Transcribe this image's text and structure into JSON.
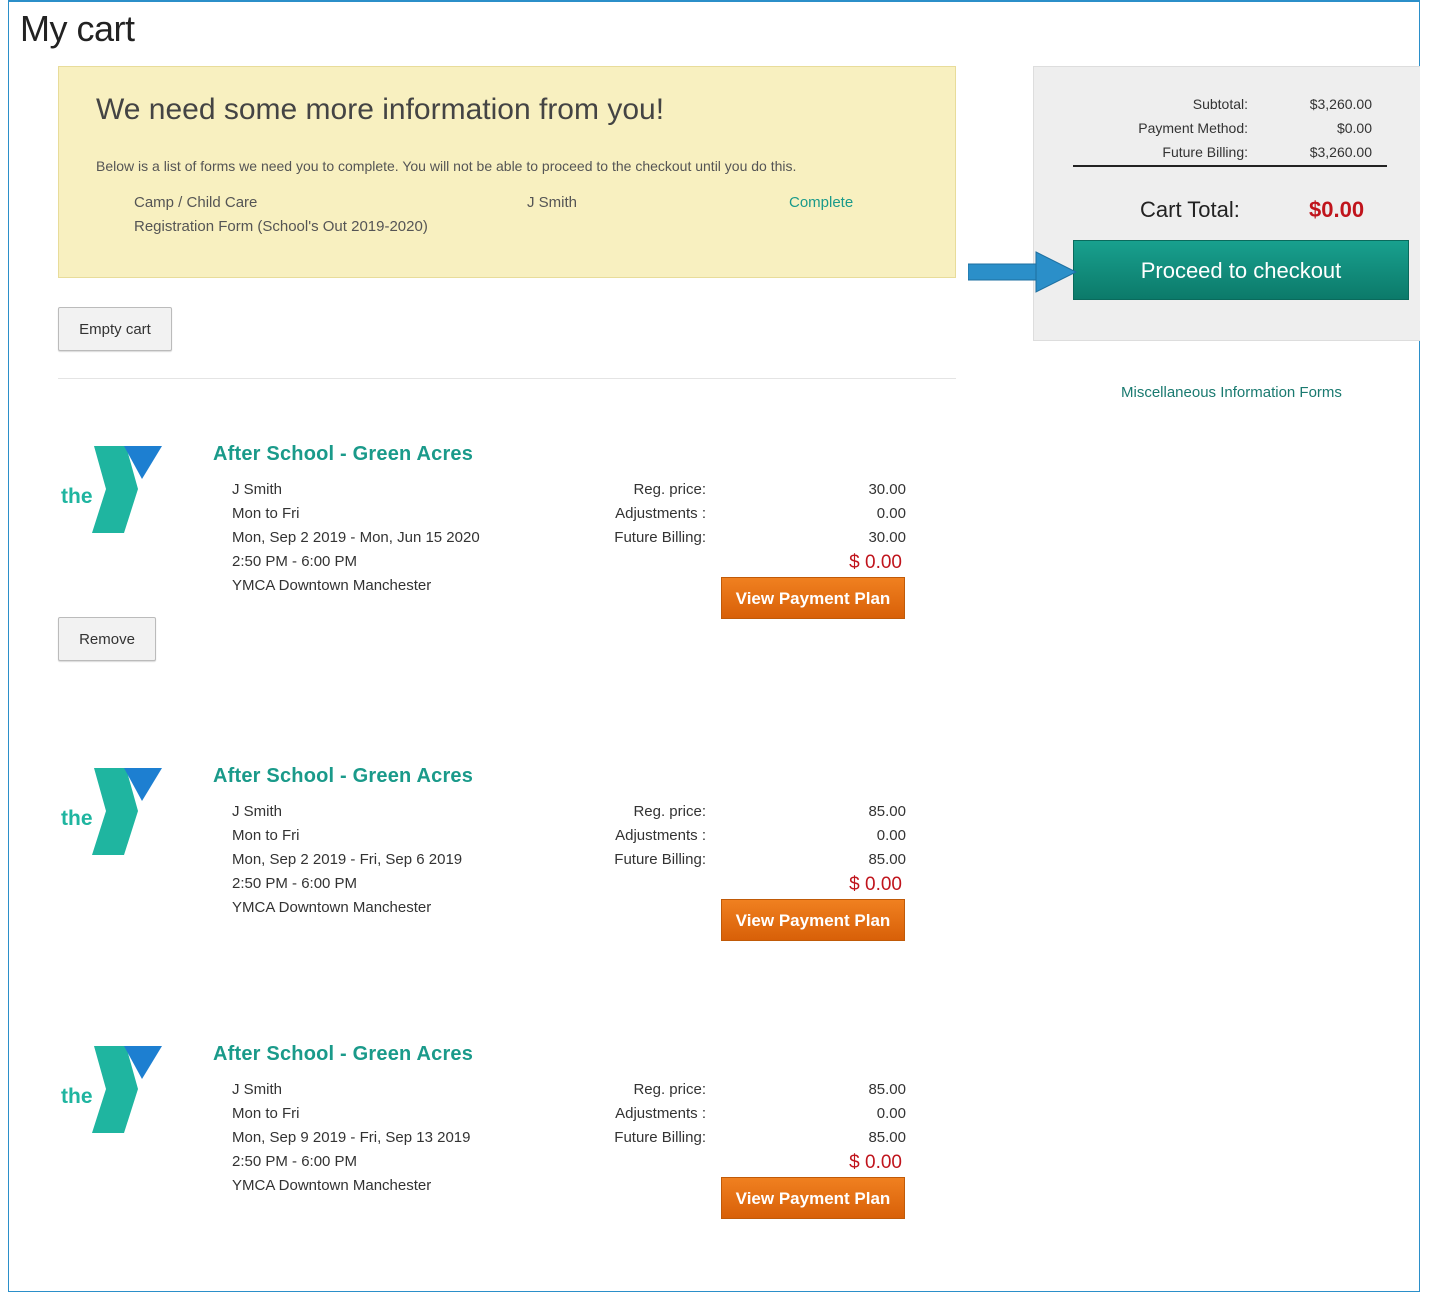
{
  "page": {
    "title": "My cart"
  },
  "notice": {
    "heading": "We need some more information from you!",
    "description": "Below is a list of forms we need you to complete. You will not be able to proceed to the checkout until you do this.",
    "forms": [
      {
        "category": "Camp / Child Care",
        "form_name": "Registration Form (School's Out 2019-2020)",
        "participant": "J Smith",
        "status": "Complete"
      }
    ]
  },
  "buttons": {
    "empty_cart": "Empty cart",
    "remove": "Remove",
    "view_payment_plan": "View Payment Plan",
    "proceed_to_checkout": "Proceed to checkout"
  },
  "summary": {
    "subtotal_label": "Subtotal:",
    "subtotal_value": "$3,260.00",
    "payment_method_label": "Payment Method:",
    "payment_method_value": "$0.00",
    "future_billing_label": "Future Billing:",
    "future_billing_value": "$3,260.00",
    "cart_total_label": "Cart Total:",
    "cart_total_value": "$0.00"
  },
  "misc_link": "Miscellaneous Information Forms",
  "logo_text": "the",
  "price_labels": {
    "reg_price": "Reg. price:",
    "adjustments": "Adjustments :",
    "future_billing": "Future Billing:"
  },
  "items": [
    {
      "title": "After School - Green Acres",
      "participant": "J Smith",
      "days": "Mon to Fri",
      "dates": "Mon, Sep 2 2019 - Mon, Jun 15 2020",
      "time": "2:50 PM - 6:00 PM",
      "location": "YMCA Downtown Manchester",
      "reg_price": "30.00",
      "adjustments": "0.00",
      "future_billing": "30.00",
      "total": "$ 0.00"
    },
    {
      "title": "After School - Green Acres",
      "participant": "J Smith",
      "days": "Mon to Fri",
      "dates": "Mon, Sep 2 2019 - Fri, Sep 6 2019",
      "time": "2:50 PM - 6:00 PM",
      "location": "YMCA Downtown Manchester",
      "reg_price": "85.00",
      "adjustments": "0.00",
      "future_billing": "85.00",
      "total": "$ 0.00"
    },
    {
      "title": "After School - Green Acres",
      "participant": "J Smith",
      "days": "Mon to Fri",
      "dates": "Mon, Sep 9 2019 - Fri, Sep 13 2019",
      "time": "2:50 PM - 6:00 PM",
      "location": "YMCA Downtown Manchester",
      "reg_price": "85.00",
      "adjustments": "0.00",
      "future_billing": "85.00",
      "total": "$ 0.00"
    }
  ],
  "colors": {
    "accent_teal": "#1a9a8a",
    "checkout_button": "#12907e",
    "payment_plan_button": "#e87010",
    "total_red": "#c0141c",
    "notice_background": "#f8f0c0",
    "arrow_blue": "#2b8fc9"
  }
}
